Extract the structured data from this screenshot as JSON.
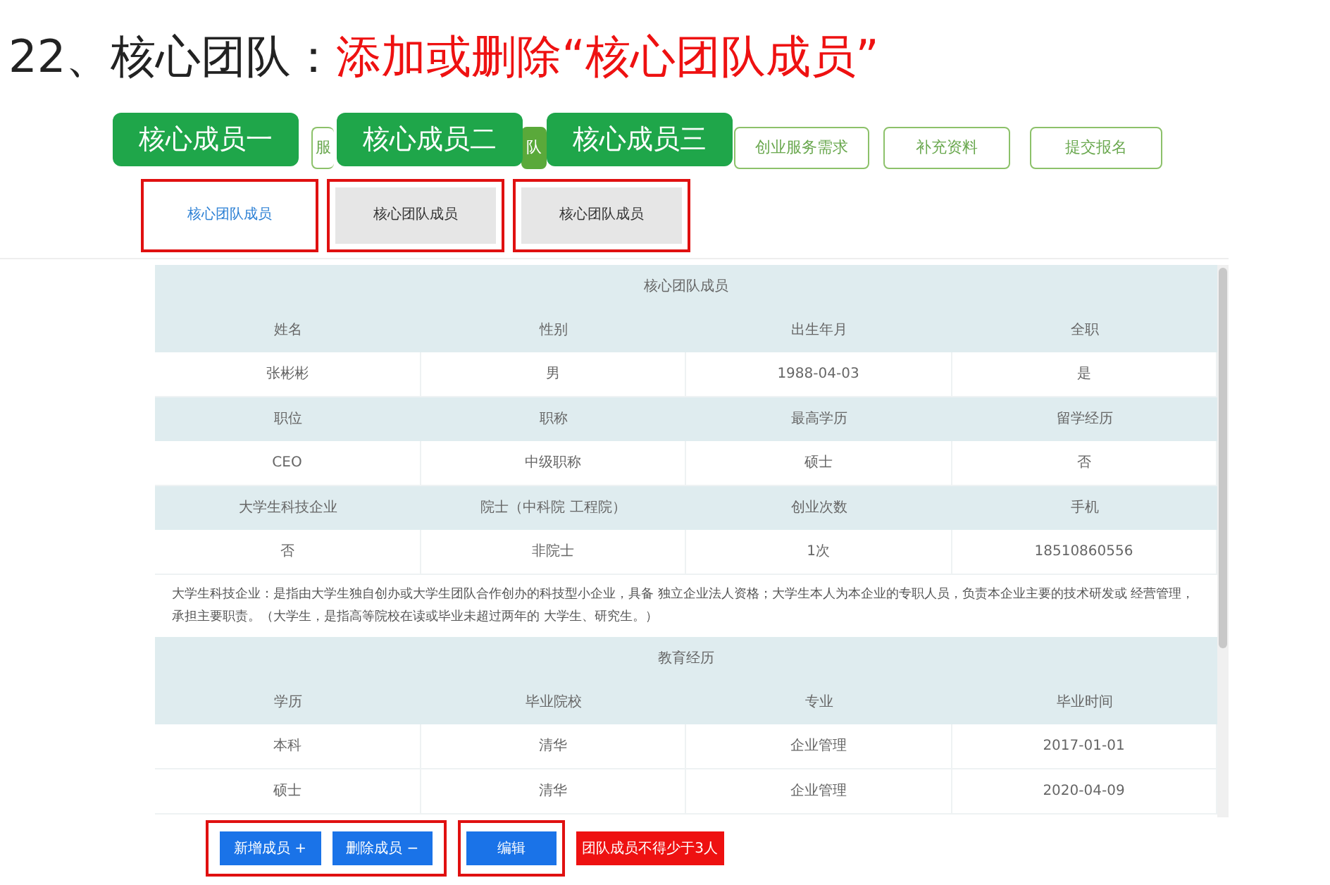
{
  "title": {
    "prefix": "22、核心团队：",
    "highlight": "添加或删除“核心团队成员”"
  },
  "nav": [
    {
      "label": "服",
      "selected": false
    },
    {
      "label": "队",
      "selected": true
    },
    {
      "label": "创业服务需求",
      "selected": false
    },
    {
      "label": "补充资料",
      "selected": false
    },
    {
      "label": "提交报名",
      "selected": false
    }
  ],
  "callouts": [
    "核心成员一",
    "核心成员二",
    "核心成员三"
  ],
  "member_tabs": [
    {
      "label": "核心团队成员",
      "selected": true
    },
    {
      "label": "核心团队成员",
      "selected": false
    },
    {
      "label": "核心团队成员",
      "selected": false
    }
  ],
  "member_section": {
    "title": "核心团队成员",
    "rows": [
      {
        "kind": "header",
        "cells": [
          "姓名",
          "性别",
          "出生年月",
          "全职"
        ]
      },
      {
        "kind": "value",
        "cells": [
          "张彬彬",
          "男",
          "1988-04-03",
          "是"
        ]
      },
      {
        "kind": "header",
        "cells": [
          "职位",
          "职称",
          "最高学历",
          "留学经历"
        ]
      },
      {
        "kind": "value",
        "cells": [
          "CEO",
          "中级职称",
          "硕士",
          "否"
        ]
      },
      {
        "kind": "header",
        "cells": [
          "大学生科技企业",
          "院士（中科院 工程院）",
          "创业次数",
          "手机"
        ]
      },
      {
        "kind": "value",
        "cells": [
          "否",
          "非院士",
          "1次",
          "18510860556"
        ]
      }
    ]
  },
  "note": "大学生科技企业：是指由大学生独自创办或大学生团队合作创办的科技型小企业，具备 独立企业法人资格；大学生本人为本企业的专职人员，负责本企业主要的技术研发或 经营管理，承担主要职责。（大学生，是指高等院校在读或毕业未超过两年的 大学生、研究生。）",
  "education_section": {
    "title": "教育经历",
    "rows": [
      {
        "kind": "header",
        "cells": [
          "学历",
          "毕业院校",
          "专业",
          "毕业时间"
        ]
      },
      {
        "kind": "value",
        "cells": [
          "本科",
          "清华",
          "企业管理",
          "2017-01-01"
        ]
      },
      {
        "kind": "value",
        "cells": [
          "硕士",
          "清华",
          "企业管理",
          "2020-04-09"
        ]
      }
    ]
  },
  "buttons": [
    {
      "label": "新增成员 +"
    },
    {
      "label": "删除成员 −"
    },
    {
      "label": "编辑"
    }
  ],
  "warning": "团队成员不得少于3人"
}
